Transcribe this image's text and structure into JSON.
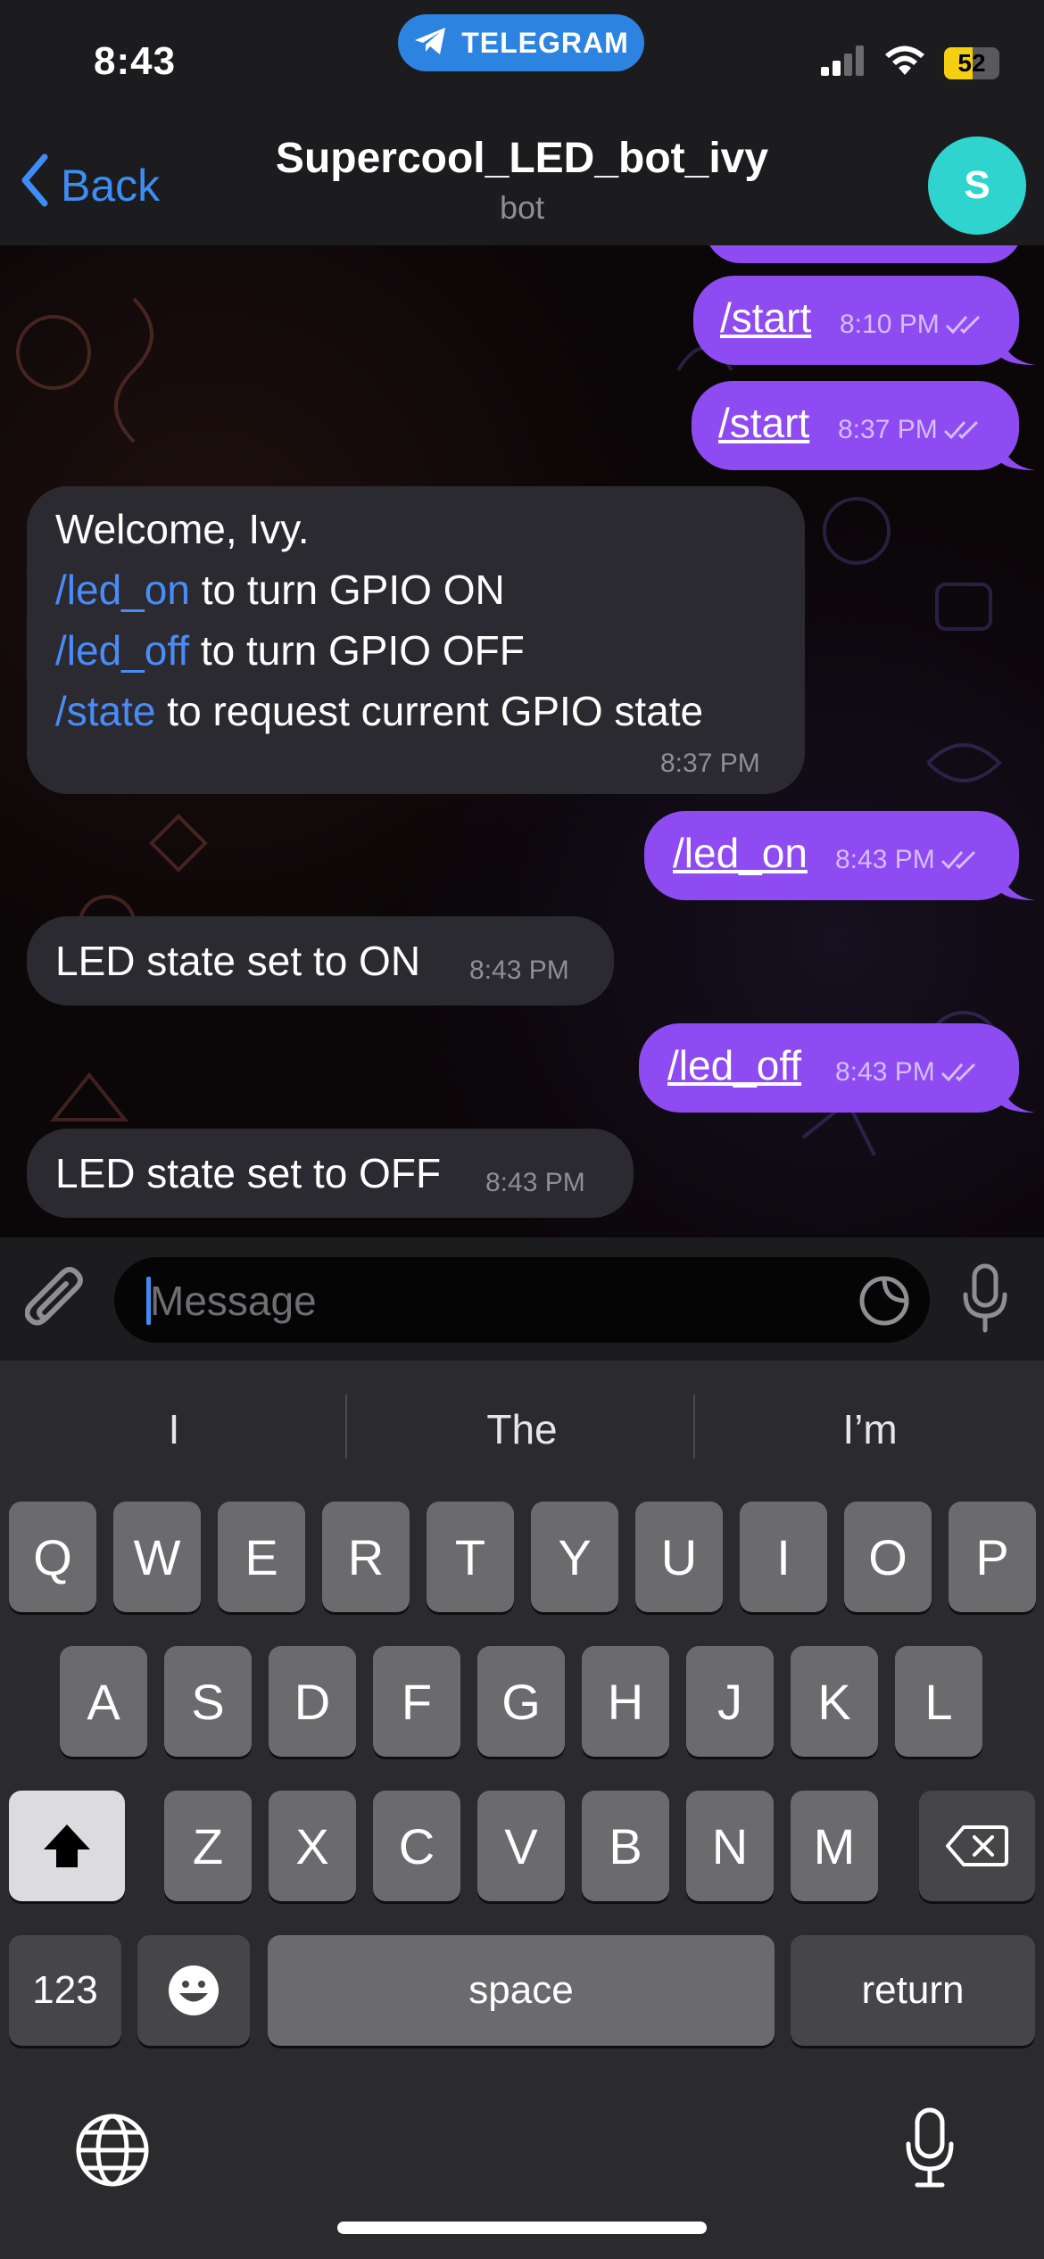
{
  "status_bar": {
    "time": "8:43",
    "app_pill": "TELEGRAM",
    "battery": "52",
    "battery_level": 0.52
  },
  "header": {
    "back_label": "Back",
    "title": "Supercool_LED_bot_ivy",
    "subtitle": "bot",
    "avatar_letter": "S",
    "avatar_color": "#2fd4cf"
  },
  "messages": [
    {
      "from": "me",
      "text": "/start",
      "time": "8:10 PM"
    },
    {
      "from": "me",
      "text": "/start",
      "time": "8:37 PM"
    },
    {
      "from": "bot",
      "lines": [
        {
          "cmd": "",
          "text": "Welcome, Ivy."
        },
        {
          "cmd": "/led_on",
          "text": " to turn GPIO ON"
        },
        {
          "cmd": "/led_off",
          "text": " to turn GPIO OFF"
        },
        {
          "cmd": "/state",
          "text": " to request current GPIO state"
        }
      ],
      "time": "8:37 PM"
    },
    {
      "from": "me",
      "text": "/led_on",
      "time": "8:43 PM"
    },
    {
      "from": "bot",
      "text": "LED state set to ON",
      "time": "8:43 PM"
    },
    {
      "from": "me",
      "text": "/led_off",
      "time": "8:43 PM"
    },
    {
      "from": "bot",
      "text": "LED state set to OFF",
      "time": "8:43 PM"
    }
  ],
  "input": {
    "placeholder": "Message"
  },
  "keyboard": {
    "suggestions": [
      "I",
      "The",
      "I’m"
    ],
    "row1": [
      "Q",
      "W",
      "E",
      "R",
      "T",
      "Y",
      "U",
      "I",
      "O",
      "P"
    ],
    "row2": [
      "A",
      "S",
      "D",
      "F",
      "G",
      "H",
      "J",
      "K",
      "L"
    ],
    "row3": [
      "Z",
      "X",
      "C",
      "V",
      "B",
      "N",
      "M"
    ],
    "numbers_key": "123",
    "space_key": "space",
    "return_key": "return"
  },
  "colors": {
    "outgoing_bubble": "#8e4bf2",
    "incoming_bubble": "#2b2a30",
    "link": "#4a8cf7",
    "accent": "#3d8df5"
  }
}
